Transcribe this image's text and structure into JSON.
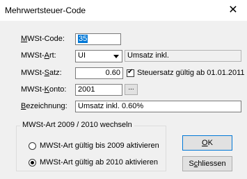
{
  "window": {
    "title": "Mehrwertsteuer-Code",
    "close_symbol": "✕"
  },
  "form": {
    "code": {
      "label_u": "M",
      "label_rest": "WSt-Code:",
      "value": "35"
    },
    "art": {
      "label_pre": "MWSt-",
      "label_u": "A",
      "label_rest": "rt:",
      "value": "UI",
      "description": "Umsatz inkl."
    },
    "satz": {
      "label_pre": "MWSt-",
      "label_u": "S",
      "label_rest": "atz:",
      "value": "0.60",
      "checkbox_checked": true,
      "checkbox_label": "Steuersatz gültig ab 01.01.2011"
    },
    "konto": {
      "label_pre": "MWSt-",
      "label_u": "K",
      "label_rest": "onto:",
      "value": "2001",
      "browse_label": "..."
    },
    "bezeichnung": {
      "label_u": "B",
      "label_rest": "ezeichnung:",
      "value": "Umsatz inkl. 0.60%"
    }
  },
  "group": {
    "title": "MWSt-Art 2009 / 2010 wechseln",
    "options": [
      {
        "label": "MWSt-Art gültig bis 2009 aktivieren",
        "checked": false
      },
      {
        "label": "MWSt-Art gültig ab 2010 aktivieren",
        "checked": true
      }
    ]
  },
  "buttons": {
    "ok": {
      "u": "O",
      "rest": "K"
    },
    "close": {
      "pre": "S",
      "u": "c",
      "rest": "hliessen"
    }
  }
}
